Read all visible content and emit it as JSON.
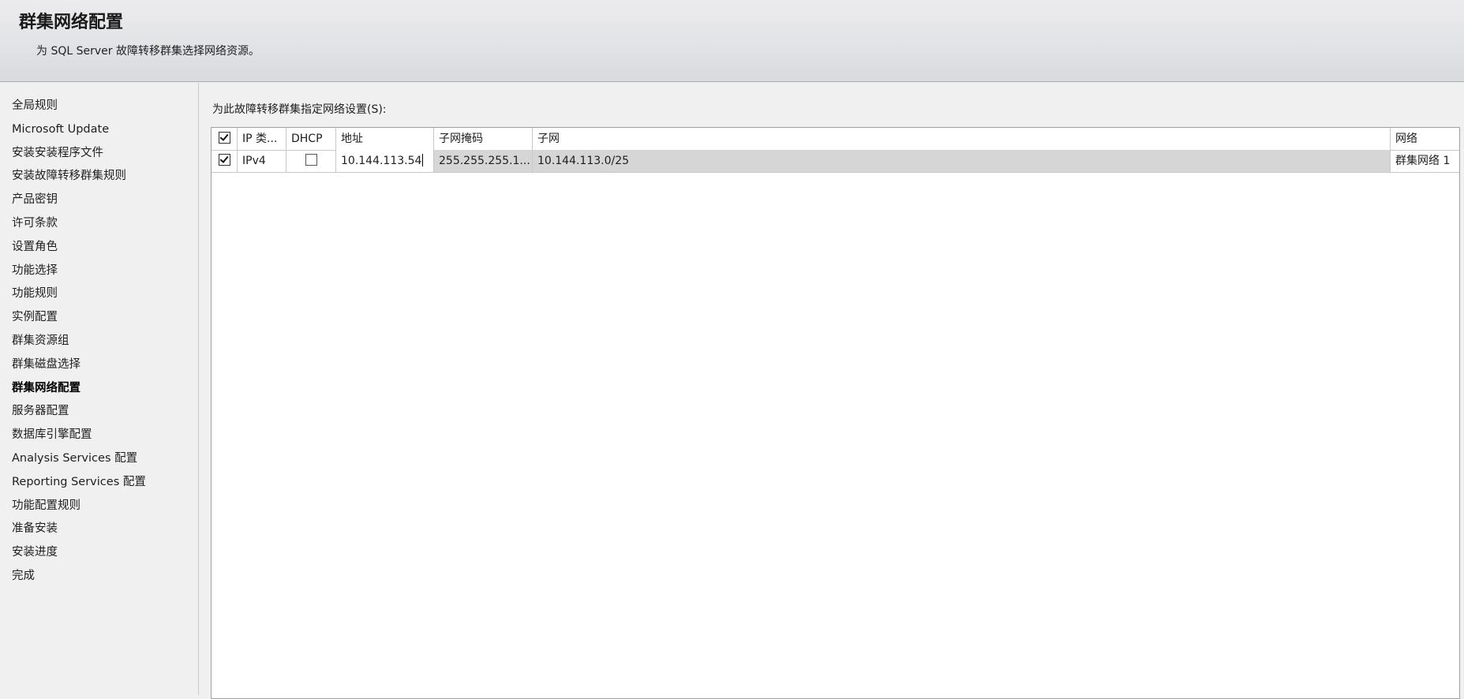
{
  "header": {
    "title": "群集网络配置",
    "subtitle": "为 SQL Server 故障转移群集选择网络资源。"
  },
  "sidebar": {
    "items": [
      {
        "label": "全局规则"
      },
      {
        "label": "Microsoft Update"
      },
      {
        "label": "安装安装程序文件"
      },
      {
        "label": "安装故障转移群集规则"
      },
      {
        "label": "产品密钥"
      },
      {
        "label": "许可条款"
      },
      {
        "label": "设置角色"
      },
      {
        "label": "功能选择"
      },
      {
        "label": "功能规则"
      },
      {
        "label": "实例配置"
      },
      {
        "label": "群集资源组"
      },
      {
        "label": "群集磁盘选择"
      },
      {
        "label": "群集网络配置",
        "active": true
      },
      {
        "label": "服务器配置"
      },
      {
        "label": "数据库引擎配置"
      },
      {
        "label": "Analysis Services 配置"
      },
      {
        "label": "Reporting Services 配置"
      },
      {
        "label": "功能配置规则"
      },
      {
        "label": "准备安装"
      },
      {
        "label": "安装进度"
      },
      {
        "label": "完成"
      }
    ]
  },
  "main": {
    "label": "为此故障转移群集指定网络设置(S):",
    "grid": {
      "header_checked": true,
      "columns": {
        "ip_type": "IP 类...",
        "dhcp": "DHCP",
        "address": "地址",
        "subnet_mask": "子网掩码",
        "subnet": "子网",
        "network": "网络"
      },
      "rows": [
        {
          "checked": true,
          "ip_type": "IPv4",
          "dhcp": false,
          "address": "10.144.113.54",
          "subnet_mask": "255.255.255.1...",
          "subnet": "10.144.113.0/25",
          "network": "群集网络 1"
        }
      ]
    }
  }
}
